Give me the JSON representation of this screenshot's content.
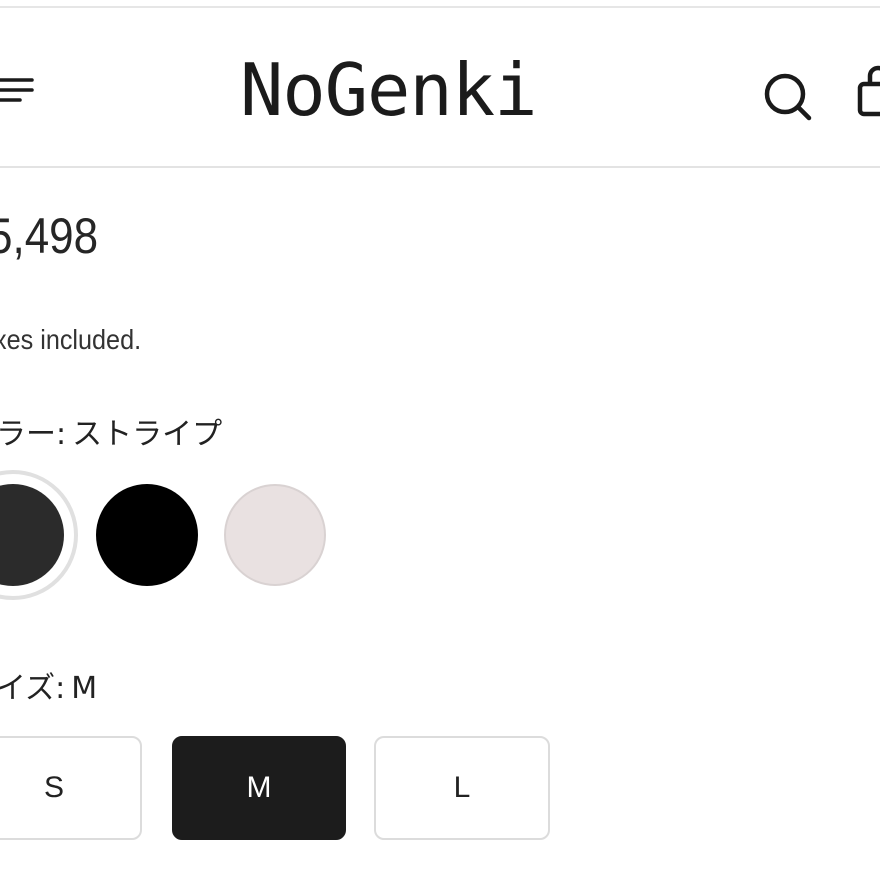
{
  "header": {
    "logo": "NoGenki",
    "icons": [
      "menu-icon",
      "search-icon",
      "cart-icon"
    ]
  },
  "product": {
    "price": "5,498",
    "tax_note": "xes included."
  },
  "color_option": {
    "label": "ラー",
    "separator": ":",
    "selected_value": "ストライプ",
    "swatches": [
      {
        "color": "#2b2b2b",
        "selected": true
      },
      {
        "color": "#000000",
        "selected": false
      },
      {
        "color": "#e9e1e1",
        "selected": false
      }
    ]
  },
  "size_option": {
    "label": "イズ",
    "separator": ":",
    "selected_value": "M",
    "options": [
      {
        "label": "S",
        "selected": false
      },
      {
        "label": "M",
        "selected": true
      },
      {
        "label": "L",
        "selected": false
      }
    ]
  },
  "colors": {
    "text": "#1a1a1a",
    "selected_size_bg": "#1c1c1c",
    "border": "#dcdcdc",
    "divider": "#e3e3e3"
  }
}
